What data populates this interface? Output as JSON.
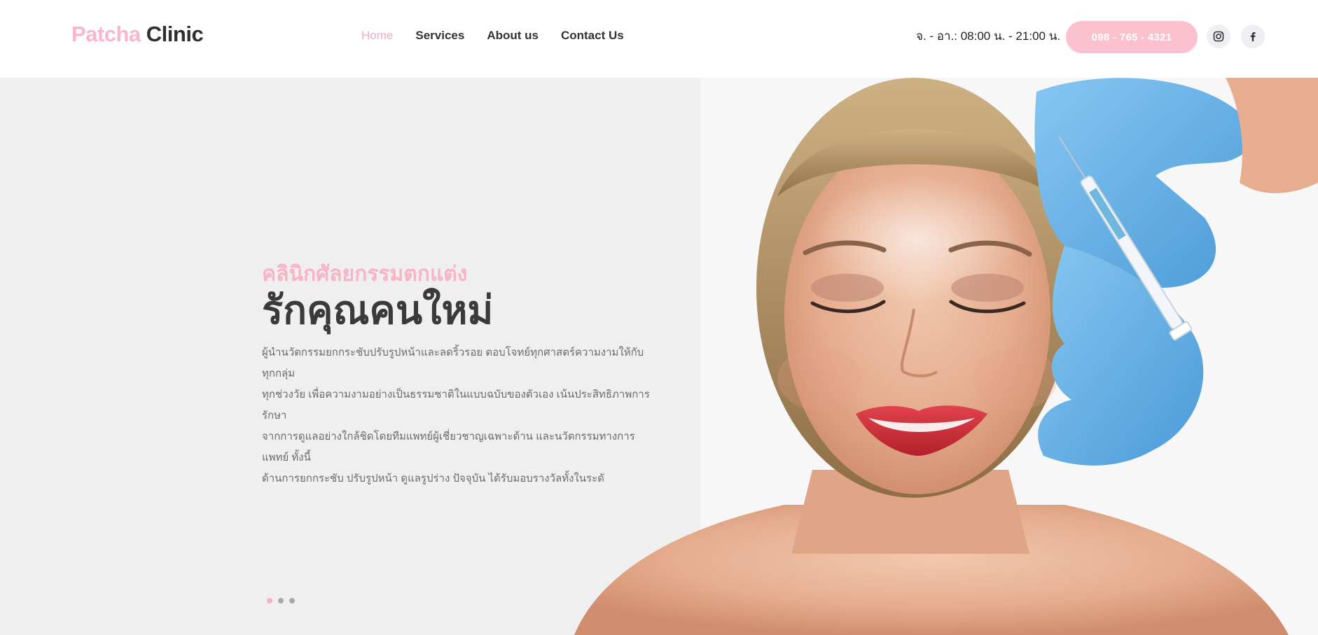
{
  "brand": {
    "name_first": "Patcha",
    "name_second": "Clinic"
  },
  "nav": {
    "items": [
      {
        "label": "Home",
        "active": true
      },
      {
        "label": "Services",
        "active": false
      },
      {
        "label": "About us",
        "active": false
      },
      {
        "label": "Contact Us",
        "active": false
      }
    ]
  },
  "header": {
    "hours": "จ. - อา.: 08:00 น. - 21:00 น.",
    "phone": "098 - 765 - 4321",
    "social": [
      {
        "icon": "instagram-icon"
      },
      {
        "icon": "facebook-icon"
      }
    ]
  },
  "hero": {
    "eyebrow": "คลินิกศัลยกรรมตกแต่ง",
    "headline": "รักคุณคนใหม่",
    "description_lines": [
      "ผู้นำนวัตกรรมยกกระชับปรับรูปหน้าและลดริ้วรอย ตอบโจทย์ทุกศาสตร์ความงามให้กับ ทุกกลุ่ม",
      "ทุกช่วงวัย เพื่อความงามอย่างเป็นธรรมชาติในแบบฉบับของตัวเอง เน้นประสิทธิภาพการรักษา",
      "จากการดูแลอย่างใกล้ชิดโดยทีมแพทย์ผู้เชี่ยวชาญเฉพาะด้าน และนวัตกรรมทางการแพทย์ ทั้งนี้",
      "ด้านการยกกระชับ ปรับรูปหน้า ดูแลรูปร่าง ปัจจุบัน ได้รับมอบรางวัลทั้งในระดั"
    ],
    "slides": {
      "count": 3,
      "active_index": 0
    }
  },
  "colors": {
    "accent": "#f9b8c9",
    "text_dark": "#2f2f2f",
    "hero_bg": "#efeff0",
    "glove": "#6fb6ea",
    "lips": "#d9343e"
  }
}
